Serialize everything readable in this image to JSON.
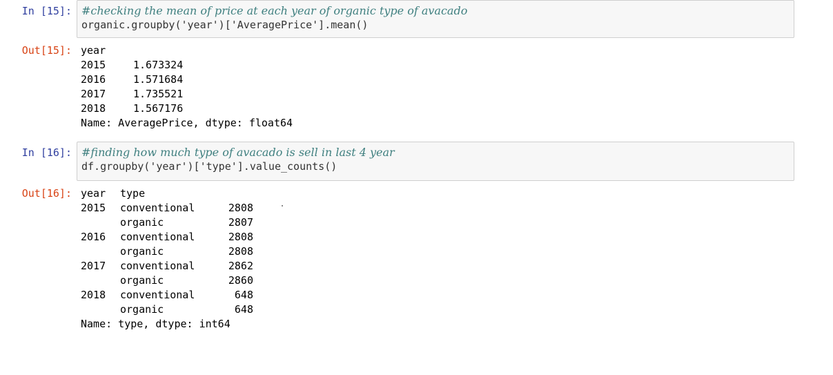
{
  "cells": [
    {
      "in_prompt": "In [15]:",
      "code_lines": [
        {
          "type": "comment",
          "text": "#checking the mean of price at each year of organic type of avacado"
        },
        {
          "type": "code",
          "text": "organic.groupby('year')['AveragePrice'].mean()"
        }
      ],
      "out_prompt": "Out[15]:",
      "output": {
        "header": "year",
        "rows": [
          {
            "year": "2015",
            "value": "1.673324"
          },
          {
            "year": "2016",
            "value": "1.571684"
          },
          {
            "year": "2017",
            "value": "1.735521"
          },
          {
            "year": "2018",
            "value": "1.567176"
          }
        ],
        "footer": "Name: AveragePrice, dtype: float64"
      }
    },
    {
      "in_prompt": "In [16]:",
      "code_lines": [
        {
          "type": "comment",
          "text": "#finding how much type of avacado is sell in last 4 year"
        },
        {
          "type": "code",
          "text": "df.groupby('year')['type'].value_counts()"
        }
      ],
      "out_prompt": "Out[16]:",
      "output": {
        "header_year": "year",
        "header_type": "type",
        "rows": [
          {
            "year": "2015",
            "type": "conventional",
            "count": "2808"
          },
          {
            "year": "",
            "type": "organic",
            "count": "2807"
          },
          {
            "year": "2016",
            "type": "conventional",
            "count": "2808"
          },
          {
            "year": "",
            "type": "organic",
            "count": "2808"
          },
          {
            "year": "2017",
            "type": "conventional",
            "count": "2862"
          },
          {
            "year": "",
            "type": "organic",
            "count": "2860"
          },
          {
            "year": "2018",
            "type": "conventional",
            "count": "648"
          },
          {
            "year": "",
            "type": "organic",
            "count": "648"
          }
        ],
        "footer": "Name: type, dtype: int64"
      }
    }
  ],
  "colors": {
    "in_prompt": "#303F9F",
    "out_prompt": "#D84315",
    "comment": "#408080",
    "input_background": "#f7f7f7",
    "input_border": "#cfcfcf"
  }
}
